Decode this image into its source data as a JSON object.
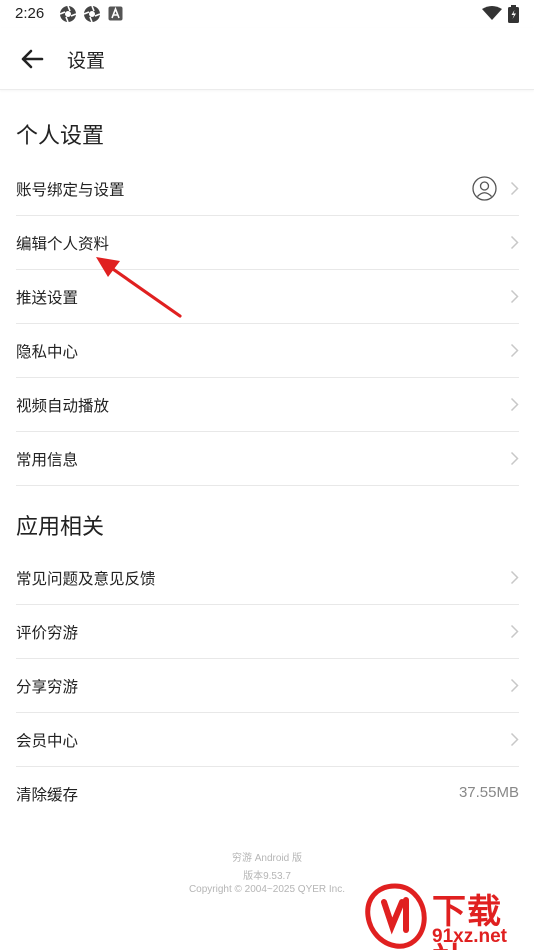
{
  "status_bar": {
    "time": "2:26"
  },
  "header": {
    "title": "设置"
  },
  "sections": {
    "personal": {
      "title": "个人设置",
      "items": [
        {
          "label": "账号绑定与设置"
        },
        {
          "label": "编辑个人资料"
        },
        {
          "label": "推送设置"
        },
        {
          "label": "隐私中心"
        },
        {
          "label": "视频自动播放"
        },
        {
          "label": "常用信息"
        }
      ]
    },
    "app": {
      "title": "应用相关",
      "items": [
        {
          "label": "常见问题及意见反馈"
        },
        {
          "label": "评价穷游"
        },
        {
          "label": "分享穷游"
        },
        {
          "label": "会员中心"
        },
        {
          "label": "清除缓存",
          "value": "37.55MB"
        }
      ]
    }
  },
  "footer": {
    "line1": "穷游 Android 版",
    "line2": "版本9.53.7",
    "line3": "Copyright © 2004~2025 QYER Inc."
  },
  "watermark": {
    "top_text": "下载站",
    "bottom_text": "91xz.net"
  },
  "colors": {
    "annotation_red": "#e02020",
    "chevron": "#c8c8c8",
    "divider": "#e8e8e8"
  }
}
